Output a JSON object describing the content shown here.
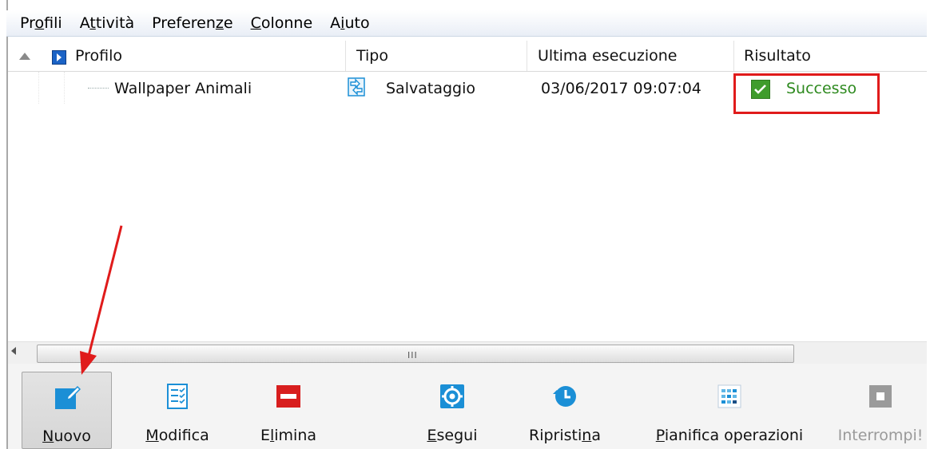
{
  "menu": [
    {
      "pre": "Pr",
      "u": "o",
      "post": "fili"
    },
    {
      "pre": "A",
      "u": "t",
      "post": "tività"
    },
    {
      "pre": "Preferen",
      "u": "z",
      "post": "e"
    },
    {
      "pre": "",
      "u": "C",
      "post": "olonne"
    },
    {
      "pre": "A",
      "u": "i",
      "post": "uto"
    }
  ],
  "columns": {
    "profile": "Profilo",
    "type": "Tipo",
    "last_run": "Ultima esecuzione",
    "result": "Risultato"
  },
  "row": {
    "profile": "Wallpaper Animali",
    "type": "Salvataggio",
    "last_run": "03/06/2017 09:07:04",
    "result": "Successo"
  },
  "toolbar": {
    "new": {
      "u": "N",
      "post": "uovo"
    },
    "edit": {
      "u": "M",
      "post": "odifica"
    },
    "delete": {
      "pre": "E",
      "u": "l",
      "post": "imina"
    },
    "run": {
      "u": "E",
      "post": "segui"
    },
    "restore": {
      "pre": "Ripristi",
      "u": "n",
      "post": "a"
    },
    "schedule": {
      "u": "P",
      "post": "ianifica operazioni"
    },
    "stop": "Interrompi!"
  },
  "scroll_grip": "III",
  "colors": {
    "accent_blue": "#1b8fd6",
    "success": "#2e8a1f",
    "highlight": "#e01b1b",
    "delete_red": "#d81e1e"
  }
}
